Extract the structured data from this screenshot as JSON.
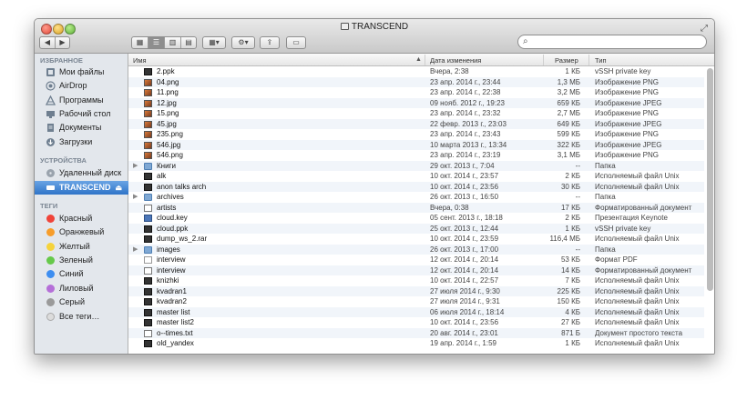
{
  "window": {
    "title": "TRANSCEND"
  },
  "toolbar": {
    "back": "◀",
    "forward": "▶",
    "search_placeholder": ""
  },
  "sidebar": {
    "favorites_header": "ИЗБРАННОЕ",
    "favorites": [
      {
        "label": "Мои файлы",
        "icon": "all-files-icon"
      },
      {
        "label": "AirDrop",
        "icon": "airdrop-icon"
      },
      {
        "label": "Программы",
        "icon": "applications-icon"
      },
      {
        "label": "Рабочий стол",
        "icon": "desktop-icon"
      },
      {
        "label": "Документы",
        "icon": "documents-icon"
      },
      {
        "label": "Загрузки",
        "icon": "downloads-icon"
      }
    ],
    "devices_header": "УСТРОЙСТВА",
    "devices": [
      {
        "label": "Удаленный диск",
        "icon": "remote-disc-icon"
      },
      {
        "label": "TRANSCEND",
        "icon": "drive-icon",
        "selected": true
      }
    ],
    "tags_header": "ТЕГИ",
    "tags": [
      {
        "label": "Красный",
        "color": "#f0443a"
      },
      {
        "label": "Оранжевый",
        "color": "#f79d2a"
      },
      {
        "label": "Желтый",
        "color": "#f5d33c"
      },
      {
        "label": "Зеленый",
        "color": "#66c94a"
      },
      {
        "label": "Синий",
        "color": "#3e8ef0"
      },
      {
        "label": "Лиловый",
        "color": "#b56fd8"
      },
      {
        "label": "Серый",
        "color": "#9a9a9a"
      },
      {
        "label": "Все теги…",
        "color": "#dcdcdc"
      }
    ]
  },
  "columns": {
    "name": "Имя",
    "date": "Дата изменения",
    "size": "Размер",
    "kind": "Тип"
  },
  "files": [
    {
      "name": "2.ppk",
      "date": "Вчера, 2:38",
      "size": "1 КБ",
      "kind": "vSSH private key",
      "icon": "exec"
    },
    {
      "name": "04.png",
      "date": "23 апр. 2014 г., 23:44",
      "size": "1,3 МБ",
      "kind": "Изображение PNG",
      "icon": "img"
    },
    {
      "name": "11.png",
      "date": "23 апр. 2014 г., 22:38",
      "size": "3,2 МБ",
      "kind": "Изображение PNG",
      "icon": "img"
    },
    {
      "name": "12.jpg",
      "date": "09 нояб. 2012 г., 19:23",
      "size": "659 КБ",
      "kind": "Изображение JPEG",
      "icon": "img"
    },
    {
      "name": "15.png",
      "date": "23 апр. 2014 г., 23:32",
      "size": "2,7 МБ",
      "kind": "Изображение PNG",
      "icon": "img"
    },
    {
      "name": "45.jpg",
      "date": "22 февр. 2013 г., 23:03",
      "size": "649 КБ",
      "kind": "Изображение JPEG",
      "icon": "img"
    },
    {
      "name": "235.png",
      "date": "23 апр. 2014 г., 23:43",
      "size": "599 КБ",
      "kind": "Изображение PNG",
      "icon": "img"
    },
    {
      "name": "546.jpg",
      "date": "10 марта 2013 г., 13:34",
      "size": "322 КБ",
      "kind": "Изображение JPEG",
      "icon": "img"
    },
    {
      "name": "546.png",
      "date": "23 апр. 2014 г., 23:19",
      "size": "3,1 МБ",
      "kind": "Изображение PNG",
      "icon": "img"
    },
    {
      "name": "Книги",
      "date": "29 окт. 2013 г., 7:04",
      "size": "--",
      "kind": "Папка",
      "icon": "folder",
      "folder": true
    },
    {
      "name": "alk",
      "date": "10 окт. 2014 г., 23:57",
      "size": "2 КБ",
      "kind": "Исполняемый файл Unix",
      "icon": "exec"
    },
    {
      "name": "anon talks arch",
      "date": "10 окт. 2014 г., 23:56",
      "size": "30 КБ",
      "kind": "Исполняемый файл Unix",
      "icon": "exec"
    },
    {
      "name": "archives",
      "date": "26 окт. 2013 г., 16:50",
      "size": "--",
      "kind": "Папка",
      "icon": "folder",
      "folder": true
    },
    {
      "name": "artists",
      "date": "Вчера, 0:38",
      "size": "17 КБ",
      "kind": "Форматированный документ",
      "icon": "doc"
    },
    {
      "name": "cloud.key",
      "date": "05 сент. 2013 г., 18:18",
      "size": "2 КБ",
      "kind": "Презентация Keynote",
      "icon": "key"
    },
    {
      "name": "cloud.ppk",
      "date": "25 окт. 2013 г., 12:44",
      "size": "1 КБ",
      "kind": "vSSH private key",
      "icon": "exec"
    },
    {
      "name": "dump_ws_2.rar",
      "date": "10 окт. 2014 г., 23:59",
      "size": "116,4 МБ",
      "kind": "Исполняемый файл Unix",
      "icon": "exec"
    },
    {
      "name": "images",
      "date": "26 окт. 2013 г., 17:00",
      "size": "--",
      "kind": "Папка",
      "icon": "folder",
      "folder": true
    },
    {
      "name": "interview",
      "date": "12 окт. 2014 г., 20:14",
      "size": "53 КБ",
      "kind": "Формат PDF",
      "icon": "pdf"
    },
    {
      "name": "interview",
      "date": "12 окт. 2014 г., 20:14",
      "size": "14 КБ",
      "kind": "Форматированный документ",
      "icon": "doc"
    },
    {
      "name": "knizhki",
      "date": "10 окт. 2014 г., 22:57",
      "size": "7 КБ",
      "kind": "Исполняемый файл Unix",
      "icon": "exec"
    },
    {
      "name": "kvadran1",
      "date": "27 июля 2014 г., 9:30",
      "size": "225 КБ",
      "kind": "Исполняемый файл Unix",
      "icon": "exec"
    },
    {
      "name": "kvadran2",
      "date": "27 июля 2014 г., 9:31",
      "size": "150 КБ",
      "kind": "Исполняемый файл Unix",
      "icon": "exec"
    },
    {
      "name": "master list",
      "date": "06 июля 2014 г., 18:14",
      "size": "4 КБ",
      "kind": "Исполняемый файл Unix",
      "icon": "exec"
    },
    {
      "name": "master list2",
      "date": "10 окт. 2014 г., 23:56",
      "size": "27 КБ",
      "kind": "Исполняемый файл Unix",
      "icon": "exec"
    },
    {
      "name": "o--times.txt",
      "date": "20 авг. 2014 г., 23:01",
      "size": "871 Б",
      "kind": "Документ простого текста",
      "icon": "doc"
    },
    {
      "name": "old_yandex",
      "date": "19 апр. 2014 г., 1:59",
      "size": "1 КБ",
      "kind": "Исполняемый файл Unix",
      "icon": "exec"
    }
  ]
}
